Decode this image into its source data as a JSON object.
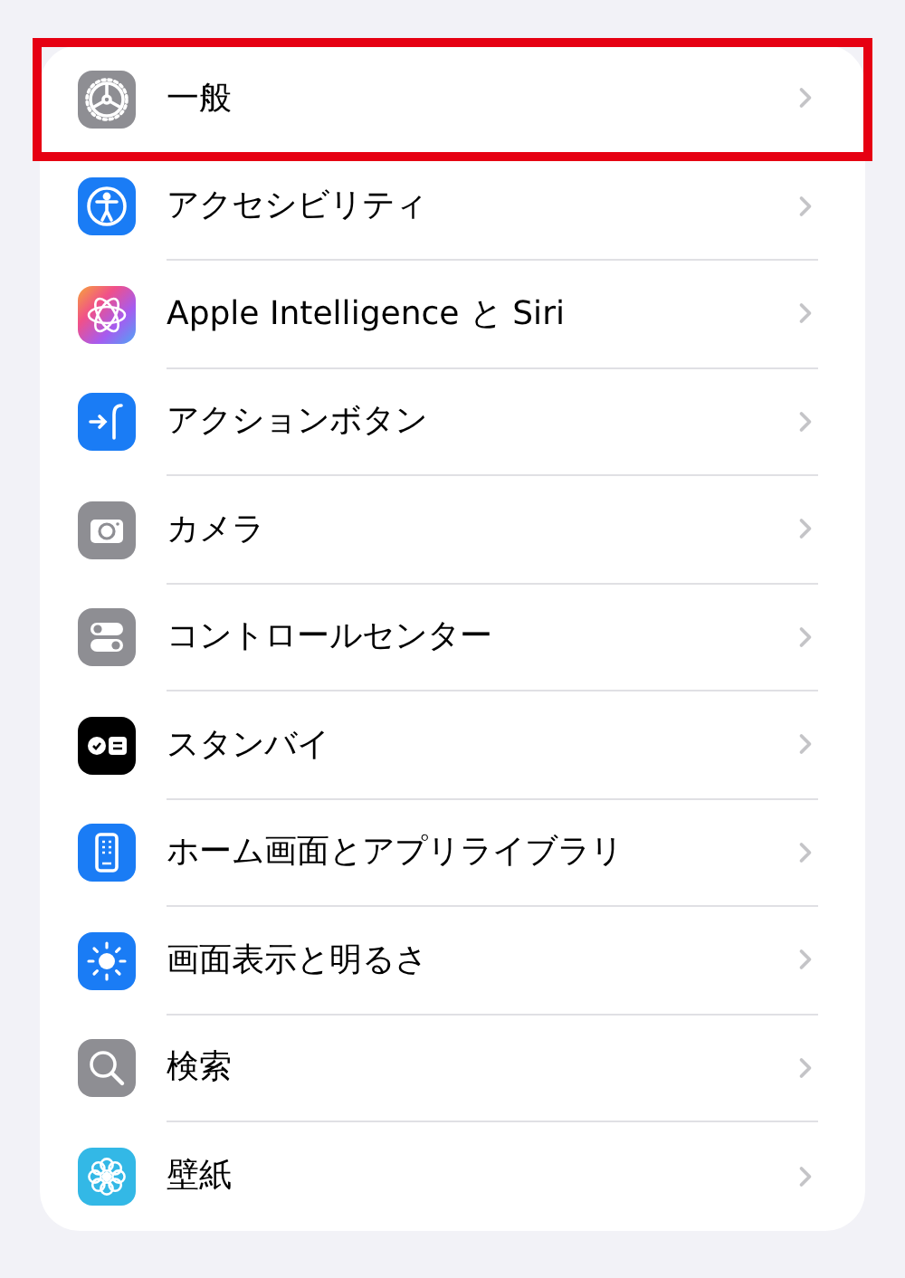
{
  "settings": {
    "items": [
      {
        "label": "一般",
        "kind": "gear",
        "highlighted": true
      },
      {
        "label": "アクセシビリティ",
        "kind": "accessibility",
        "highlighted": false
      },
      {
        "label": "Apple Intelligence と Siri",
        "kind": "intelligence",
        "highlighted": false
      },
      {
        "label": "アクションボタン",
        "kind": "action",
        "highlighted": false
      },
      {
        "label": "カメラ",
        "kind": "camera",
        "highlighted": false
      },
      {
        "label": "コントロールセンター",
        "kind": "toggles",
        "highlighted": false
      },
      {
        "label": "スタンバイ",
        "kind": "standby",
        "highlighted": false
      },
      {
        "label": "ホーム画面とアプリライブラリ",
        "kind": "phone",
        "highlighted": false
      },
      {
        "label": "画面表示と明るさ",
        "kind": "brightness",
        "highlighted": false
      },
      {
        "label": "検索",
        "kind": "search",
        "highlighted": false
      },
      {
        "label": "壁紙",
        "kind": "flower",
        "highlighted": false
      }
    ]
  }
}
